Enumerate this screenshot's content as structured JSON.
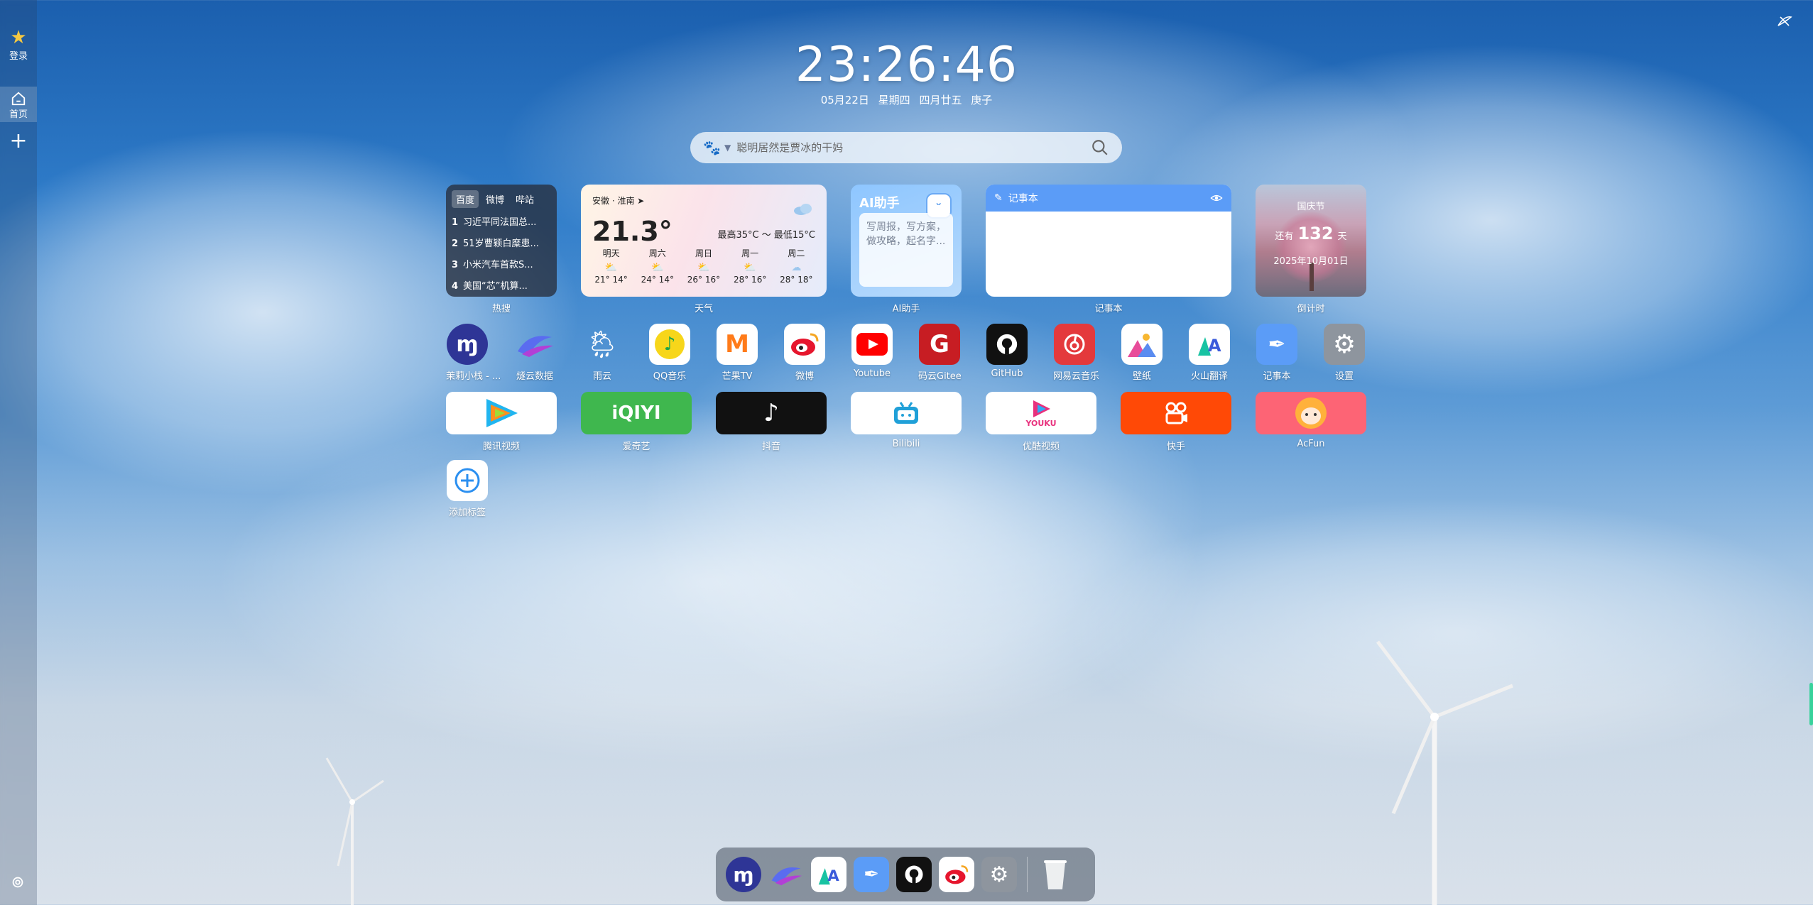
{
  "sidebar": {
    "login_label": "登录",
    "home_label": "首页",
    "add_glyph": "+"
  },
  "clock": {
    "time": "23:26:46",
    "date": "05月22日",
    "weekday": "星期四",
    "lunar": "四月廿五",
    "ganzhi": "庚子"
  },
  "search": {
    "placeholder": "聪明居然是贾冰的干妈",
    "engine_icon": "baidu-paw-icon"
  },
  "widgets": {
    "hot": {
      "label": "热搜",
      "tabs": [
        "百度",
        "微博",
        "哔站"
      ],
      "items": [
        {
          "rank": "1",
          "text": "习近平同法国总..."
        },
        {
          "rank": "2",
          "text": "51岁曹颖白糜患..."
        },
        {
          "rank": "3",
          "text": "小米汽车首款S..."
        },
        {
          "rank": "4",
          "text": "美国“芯”机算..."
        }
      ]
    },
    "weather": {
      "label": "天气",
      "location": "安徽 · 淮南",
      "temp": "21.3°",
      "range": "最高35°C ～ 最低15°C",
      "days": [
        {
          "name": "明天",
          "temp": "21° 14°"
        },
        {
          "name": "周六",
          "temp": "24° 14°"
        },
        {
          "name": "周日",
          "temp": "26° 16°"
        },
        {
          "name": "周一",
          "temp": "28° 16°"
        },
        {
          "name": "周二",
          "temp": "28° 18°"
        }
      ]
    },
    "ai": {
      "label": "AI助手",
      "title": "AI助手",
      "prompt": "写周报，写方案，做攻略，起名字..."
    },
    "note": {
      "label": "记事本",
      "title": "记事本"
    },
    "countdown": {
      "label": "倒计时",
      "event": "国庆节",
      "prefix": "还有",
      "days": "132",
      "suffix": "天",
      "date": "2025年10月01日"
    }
  },
  "apps_row1": [
    {
      "label": "茉莉小栈 - ...",
      "icon": "molly-m-icon",
      "bg": "#2e3596"
    },
    {
      "label": "燧云数据",
      "icon": "swirl-logo-icon",
      "bg": "transparent"
    },
    {
      "label": "雨云",
      "icon": "sun-rain-cloud-icon",
      "bg": "transparent"
    },
    {
      "label": "QQ音乐",
      "icon": "qq-music-icon",
      "bg": "#ffffff"
    },
    {
      "label": "芒果TV",
      "icon": "mango-tv-icon",
      "bg": "#ffffff"
    },
    {
      "label": "微博",
      "icon": "weibo-icon",
      "bg": "#ffffff"
    },
    {
      "label": "Youtube",
      "icon": "youtube-icon",
      "bg": "#ffffff"
    },
    {
      "label": "码云Gitee",
      "icon": "gitee-icon",
      "bg": "#c71d23"
    },
    {
      "label": "GitHub",
      "icon": "github-icon",
      "bg": "#111111"
    },
    {
      "label": "网易云音乐",
      "icon": "netease-music-icon",
      "bg": "#e4393c"
    },
    {
      "label": "壁纸",
      "icon": "wallpaper-icon",
      "bg": "#ffffff"
    },
    {
      "label": "火山翻译",
      "icon": "volcano-translate-icon",
      "bg": "#ffffff"
    },
    {
      "label": "记事本",
      "icon": "notebook-feather-icon",
      "bg": "#5b9cf7"
    },
    {
      "label": "设置",
      "icon": "settings-gear-icon",
      "bg": "#8e959e"
    }
  ],
  "apps_row2": [
    {
      "label": "腾讯视频",
      "icon": "tencent-video-icon",
      "bg": "#ffffff"
    },
    {
      "label": "爱奇艺",
      "icon": "iqiyi-icon",
      "bg": "#3fb74e",
      "text": "iQIYI"
    },
    {
      "label": "抖音",
      "icon": "douyin-icon",
      "bg": "#111111"
    },
    {
      "label": "Bilibili",
      "icon": "bilibili-icon",
      "bg": "#ffffff"
    },
    {
      "label": "优酷视频",
      "icon": "youku-icon",
      "bg": "#ffffff",
      "text": "YOUKU"
    },
    {
      "label": "快手",
      "icon": "kuaishou-icon",
      "bg": "#ff4906"
    },
    {
      "label": "AcFun",
      "icon": "acfun-icon",
      "bg": "#fd6475"
    }
  ],
  "add_tab": {
    "label": "添加标签",
    "icon": "plus-circle-icon"
  },
  "dock": [
    "molly-m-icon",
    "swirl-logo-icon",
    "volcano-translate-icon",
    "notebook-feather-icon",
    "github-icon",
    "weibo-icon",
    "settings-gear-icon",
    "trash-bin-icon"
  ]
}
